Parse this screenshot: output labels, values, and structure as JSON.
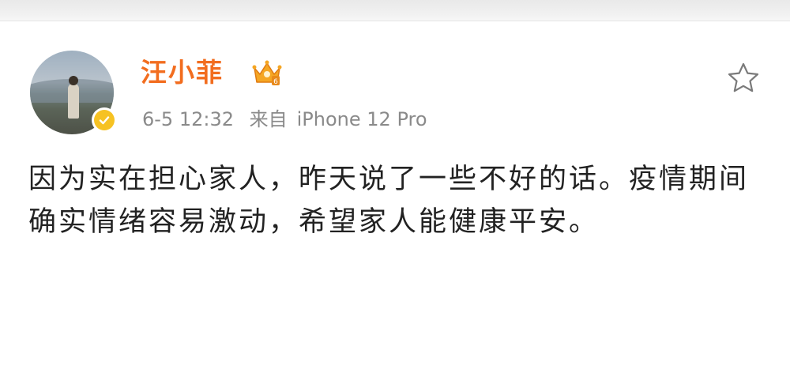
{
  "post": {
    "user_name": "汪小菲",
    "timestamp": "6-5 12:32",
    "source_prefix": "来自",
    "source_device": "iPhone 12 Pro",
    "text": "因为实在担心家人，昨天说了一些不好的话。疫情期间确实情绪容易激动，希望家人能健康平安。"
  },
  "icons": {
    "avatar": "user-avatar",
    "verified": "verified-badge-icon",
    "vip": "vip-crown-icon",
    "favorite": "star-icon"
  },
  "colors": {
    "user_name": "#f26d1f",
    "meta_text": "#8a8a8a",
    "body_text": "#222222",
    "verified_badge": "#f6c223"
  }
}
